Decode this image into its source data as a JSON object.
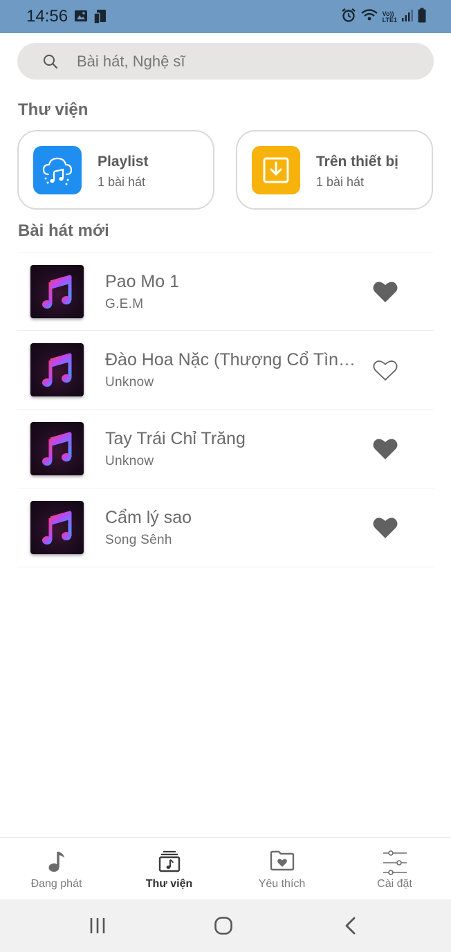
{
  "status_bar": {
    "time": "14:56",
    "icons": [
      "gallery-icon",
      "cast-icon",
      "alarm-icon",
      "wifi-icon",
      "volte-icon",
      "signal-icon",
      "battery-icon"
    ],
    "volte_text": "Vo))",
    "lte_text": "LTE1"
  },
  "search": {
    "placeholder": "Bài hát, Nghệ sĩ"
  },
  "library": {
    "title": "Thư viện",
    "cards": [
      {
        "title": "Playlist",
        "subtitle": "1 bài hát",
        "icon": "cloud-music-icon",
        "color": "#1e8ff0"
      },
      {
        "title": "Trên thiết bị",
        "subtitle": "1 bài hát",
        "icon": "download-icon",
        "color": "#f7b30b"
      }
    ]
  },
  "new_songs": {
    "title": "Bài hát mới",
    "songs": [
      {
        "title": "Pao Mo 1",
        "artist": "G.E.M",
        "favorite": true
      },
      {
        "title": "Đào Hoa Nặc (Thượng Cổ Tình Ca)",
        "artist": "Unknow",
        "favorite": false
      },
      {
        "title": "Tay Trái Chỉ Trăng",
        "artist": "Unknow",
        "favorite": true
      },
      {
        "title": "Cẩm lý sao",
        "artist": "Song Sênh",
        "favorite": true
      }
    ]
  },
  "bottom_nav": {
    "items": [
      {
        "label": "Đang phát",
        "icon": "music-note-icon",
        "active": false
      },
      {
        "label": "Thư viện",
        "icon": "library-icon",
        "active": true
      },
      {
        "label": "Yêu thích",
        "icon": "favorite-folder-icon",
        "active": false
      },
      {
        "label": "Cài đặt",
        "icon": "settings-sliders-icon",
        "active": false
      }
    ]
  },
  "system_nav": {
    "buttons": [
      "recents-icon",
      "home-icon",
      "back-icon"
    ]
  },
  "colors": {
    "status_bar": "#6e9ac3",
    "heart": "#616161",
    "playlist_tile": "#1e8ff0",
    "device_tile": "#f7b30b"
  }
}
